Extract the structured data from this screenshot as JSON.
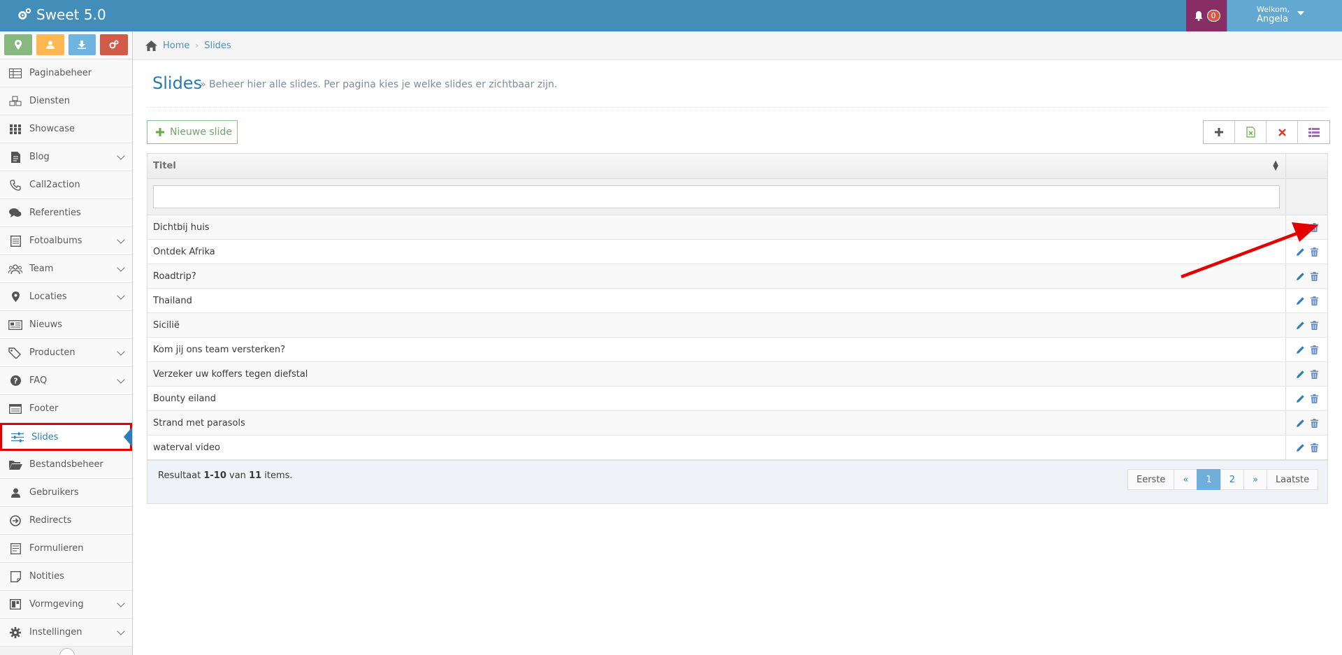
{
  "app": {
    "title": "Sweet 5.0"
  },
  "header": {
    "notifications_count": "0",
    "welcome": "Welkom,",
    "user_name": "Angela"
  },
  "shortcuts": [
    {
      "icon": "map-marker-icon",
      "color": "#87b87f"
    },
    {
      "icon": "user-icon",
      "color": "#ffb752"
    },
    {
      "icon": "download-icon",
      "color": "#6fb3e0"
    },
    {
      "icon": "cogs-icon",
      "color": "#d15b47"
    }
  ],
  "sidebar": {
    "items": [
      {
        "label": "Paginabeheer",
        "icon": "table-icon",
        "submenu": false
      },
      {
        "label": "Diensten",
        "icon": "cubes-icon",
        "submenu": false
      },
      {
        "label": "Showcase",
        "icon": "grid-icon",
        "submenu": false
      },
      {
        "label": "Blog",
        "icon": "document-icon",
        "submenu": true
      },
      {
        "label": "Call2action",
        "icon": "phone-icon",
        "submenu": false
      },
      {
        "label": "Referenties",
        "icon": "comments-icon",
        "submenu": false
      },
      {
        "label": "Fotoalbums",
        "icon": "album-icon",
        "submenu": true
      },
      {
        "label": "Team",
        "icon": "users-icon",
        "submenu": true
      },
      {
        "label": "Locaties",
        "icon": "map-marker-icon",
        "submenu": true
      },
      {
        "label": "Nieuws",
        "icon": "newspaper-icon",
        "submenu": false
      },
      {
        "label": "Producten",
        "icon": "tags-icon",
        "submenu": true
      },
      {
        "label": "FAQ",
        "icon": "question-icon",
        "submenu": true
      },
      {
        "label": "Footer",
        "icon": "footer-icon",
        "submenu": false
      },
      {
        "label": "Slides",
        "icon": "sliders-icon",
        "submenu": false,
        "active": true
      },
      {
        "label": "Bestandsbeheer",
        "icon": "folder-open-icon",
        "submenu": false
      },
      {
        "label": "Gebruikers",
        "icon": "user-icon",
        "submenu": false
      },
      {
        "label": "Redirects",
        "icon": "redirect-icon",
        "submenu": false
      },
      {
        "label": "Formulieren",
        "icon": "form-icon",
        "submenu": false
      },
      {
        "label": "Notities",
        "icon": "note-icon",
        "submenu": false
      },
      {
        "label": "Vormgeving",
        "icon": "layout-icon",
        "submenu": true
      },
      {
        "label": "Instellingen",
        "icon": "gear-icon",
        "submenu": true
      }
    ]
  },
  "breadcrumb": {
    "home": "Home",
    "current": "Slides"
  },
  "page": {
    "title": "Slides",
    "subtitle": "» Beheer hier alle slides. Per pagina kies je welke slides er zichtbaar zijn."
  },
  "toolbar": {
    "new_label": "Nieuwe slide"
  },
  "table": {
    "column_title": "Titel",
    "filter_value": "",
    "rows": [
      "Dichtbij huis",
      "Ontdek Afrika",
      "Roadtrip?",
      "Thailand",
      "Sicilië",
      "Kom jij ons team versterken?",
      "Verzeker uw koffers tegen diefstal",
      "Bounty eiland",
      "Strand met parasols",
      "waterval video"
    ]
  },
  "footer": {
    "result_prefix": "Resultaat ",
    "result_range": "1-10",
    "result_mid": " van ",
    "result_total": "11",
    "result_suffix": " items."
  },
  "pagination": {
    "first": "Eerste",
    "prev": "«",
    "pages": [
      "1",
      "2"
    ],
    "active_page": "1",
    "next": "»",
    "last": "Laatste"
  },
  "colors": {
    "navbar": "#438eb9",
    "accent": "#2679b5",
    "notify": "#892e65",
    "highlight": "#e20000"
  }
}
